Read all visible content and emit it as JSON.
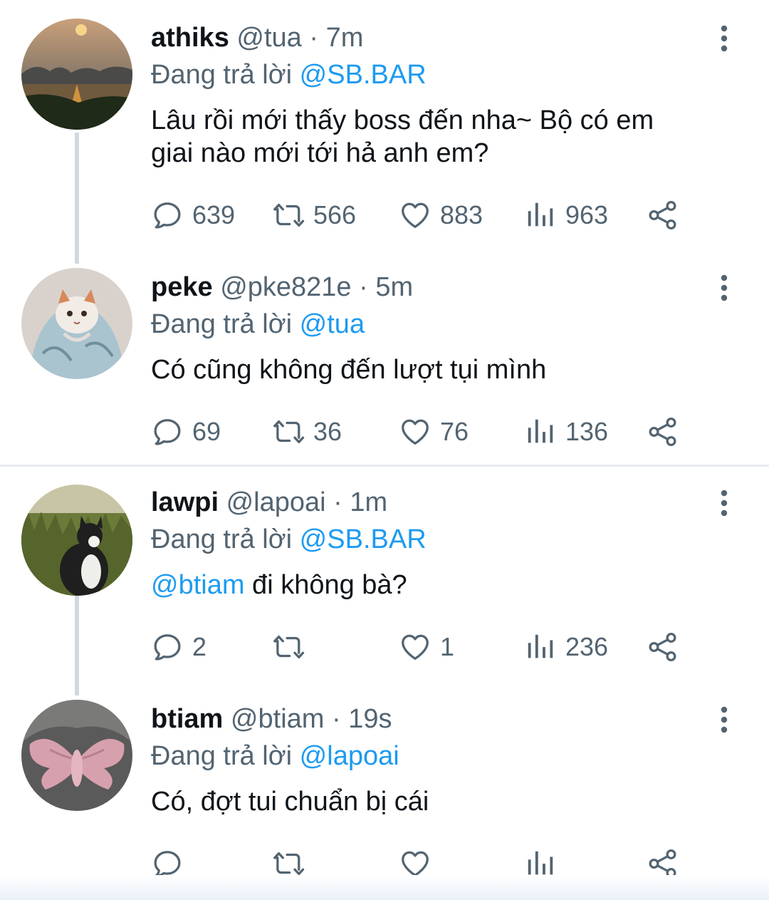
{
  "replying_label": "Đang trả lời",
  "colors": {
    "text": "#0f1419",
    "secondary": "#536471",
    "link": "#1d9bf0",
    "thread_line": "#cfd9de"
  },
  "tweets": [
    {
      "name": "athiks",
      "handle": "@tua",
      "dot": "·",
      "time": "7m",
      "replying_to": "@SB.BAR",
      "text_line1": "Lâu rồi mới thấy boss đến nha~ Bộ có em",
      "text_line2": "giai nào mới tới hả anh em?",
      "replies": "639",
      "retweets": "566",
      "likes": "883",
      "views": "963",
      "avatar_icon": "sunset-bay-avatar"
    },
    {
      "name": "peke",
      "handle": "@pke821e",
      "dot": "·",
      "time": "5m",
      "replying_to": "@tua",
      "text": "Có cũng không đến lượt tụi mình",
      "replies": "69",
      "retweets": "36",
      "likes": "76",
      "views": "136",
      "avatar_icon": "blanket-cat-avatar"
    },
    {
      "name": "lawpi",
      "handle": "@lapoai",
      "dot": "·",
      "time": "1m",
      "replying_to": "@SB.BAR",
      "text_mention": "@btiam",
      "text_rest": " đi không bà?",
      "replies": "2",
      "retweets": "",
      "likes": "1",
      "views": "236",
      "avatar_icon": "grass-cat-avatar"
    },
    {
      "name": "btiam",
      "handle": "@btiam",
      "dot": "·",
      "time": "19s",
      "replying_to": "@lapoai",
      "text": "Có, đợt tui chuẩn bị cái",
      "replies": "",
      "retweets": "",
      "likes": "",
      "views": "",
      "avatar_icon": "pink-moth-avatar"
    }
  ]
}
